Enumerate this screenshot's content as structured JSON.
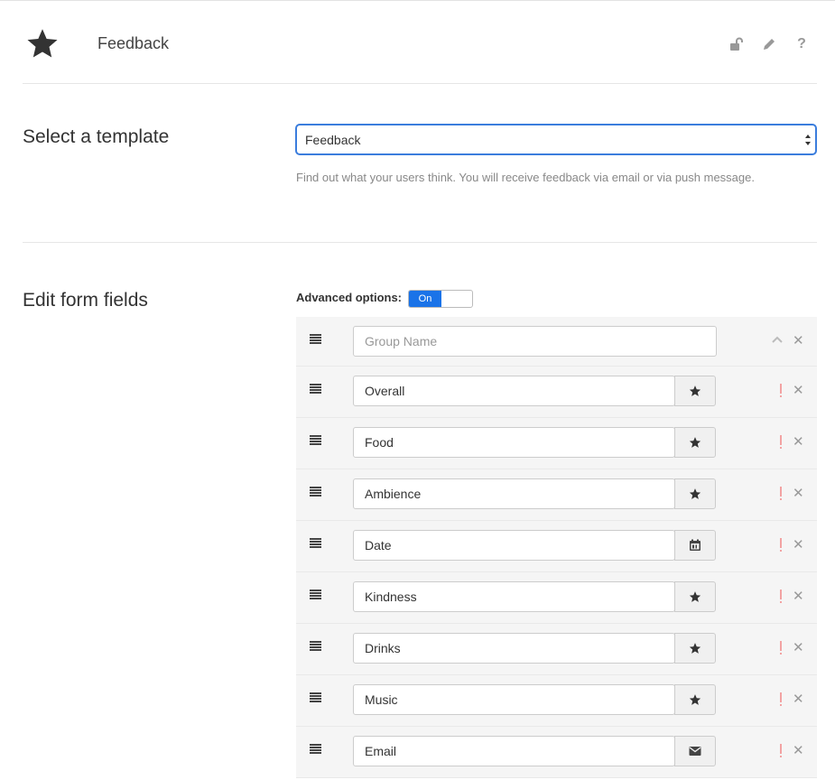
{
  "header": {
    "title": "Feedback",
    "icons": {
      "logo": "star-icon",
      "lock": "unlock-icon",
      "edit": "pencil-icon",
      "help": "help-icon"
    },
    "help_glyph": "?"
  },
  "template": {
    "heading": "Select a template",
    "selected": "Feedback",
    "description": "Find out what your users think. You will receive feedback via email or via push message."
  },
  "form": {
    "heading": "Edit form fields",
    "advanced_label": "Advanced options:",
    "advanced_toggle": "On",
    "group_placeholder": "Group Name",
    "fields": [
      {
        "label": "Overall",
        "type_icon": "star-icon"
      },
      {
        "label": "Food",
        "type_icon": "star-icon"
      },
      {
        "label": "Ambience",
        "type_icon": "star-icon"
      },
      {
        "label": "Date",
        "type_icon": "calendar-icon"
      },
      {
        "label": "Kindness",
        "type_icon": "star-icon"
      },
      {
        "label": "Drinks",
        "type_icon": "star-icon"
      },
      {
        "label": "Music",
        "type_icon": "star-icon"
      },
      {
        "label": "Email",
        "type_icon": "envelope-icon"
      }
    ],
    "remove_glyph": "✕"
  },
  "colors": {
    "accent": "#1a73e8",
    "required": "#f2a3a3",
    "muted": "#999999"
  }
}
